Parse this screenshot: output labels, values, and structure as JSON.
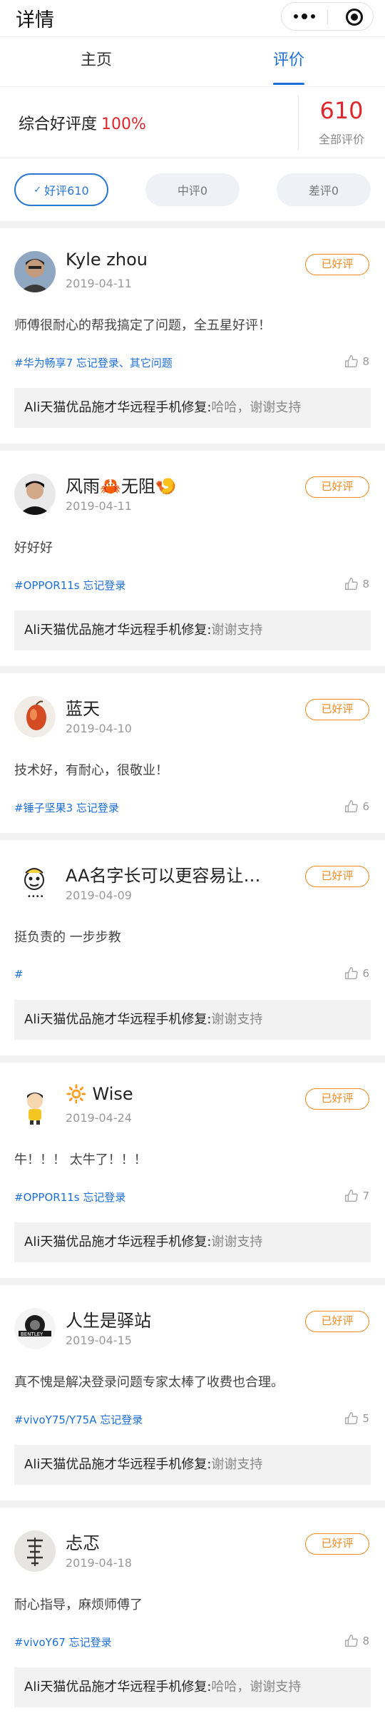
{
  "header": {
    "title": "详情"
  },
  "tabs": [
    {
      "label": "主页",
      "active": false
    },
    {
      "label": "评价",
      "active": true
    }
  ],
  "summary": {
    "label": "综合好评度",
    "percent": "100%",
    "count": "610",
    "count_label": "全部评价"
  },
  "filters": [
    {
      "label": "好评610",
      "active": true
    },
    {
      "label": "中评0",
      "active": false
    },
    {
      "label": "差评0",
      "active": false
    }
  ],
  "reviews": [
    {
      "name": "Kyle zhou",
      "date": "2019-04-11",
      "badge": "已好评",
      "content": "师傅很耐心的帮我搞定了问题，全五星好评！",
      "tag": "#华为畅享7 忘记登录、其它问题",
      "likes": "8",
      "reply_author": "Ali天猫优品施才华远程手机修复:",
      "reply_text": "哈哈，谢谢支持"
    },
    {
      "name": "风雨🦀无阻🍤",
      "date": "2019-04-11",
      "badge": "已好评",
      "content": "好好好",
      "tag": "#OPPOR11s 忘记登录",
      "likes": "8",
      "reply_author": "Ali天猫优品施才华远程手机修复:",
      "reply_text": "谢谢支持"
    },
    {
      "name": "蓝天",
      "date": "2019-04-10",
      "badge": "已好评",
      "content": "技术好，有耐心，很敬业！",
      "tag": "#锤子坚果3 忘记登录",
      "likes": "6",
      "reply_author": "",
      "reply_text": ""
    },
    {
      "name": "AA名字长可以更容易让朋…",
      "date": "2019-04-09",
      "badge": "已好评",
      "content": "挺负责的 一步步教",
      "tag": "#",
      "likes": "6",
      "reply_author": "Ali天猫优品施才华远程手机修复:",
      "reply_text": "谢谢支持"
    },
    {
      "name": "🔆 Wise",
      "date": "2019-04-24",
      "badge": "已好评",
      "content": "牛！！！ 太牛了！！！",
      "tag": "#OPPOR11s 忘记登录",
      "likes": "7",
      "reply_author": "Ali天猫优品施才华远程手机修复:",
      "reply_text": "谢谢支持"
    },
    {
      "name": "人生是驿站",
      "date": "2019-04-15",
      "badge": "已好评",
      "content": "真不愧是解决登录问题专家太棒了收费也合理。",
      "tag": "#vivoY75/Y75A 忘记登录",
      "likes": "5",
      "reply_author": "Ali天猫优品施才华远程手机修复:",
      "reply_text": "谢谢支持"
    },
    {
      "name": "忐忑",
      "date": "2019-04-18",
      "badge": "已好评",
      "content": "耐心指导，麻烦师傅了",
      "tag": "#vivoY67 忘记登录",
      "likes": "8",
      "reply_author": "Ali天猫优品施才华远程手机修复:",
      "reply_text": "哈哈，谢谢支持"
    }
  ],
  "colors": {
    "accent": "#1d6fd8",
    "price_red": "#e0262b",
    "badge_orange": "#f08a1e"
  }
}
